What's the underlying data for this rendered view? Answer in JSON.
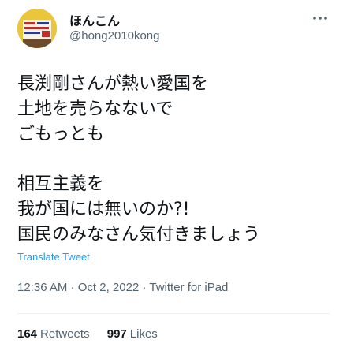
{
  "user": {
    "display_name": "ほんこん",
    "handle": "@hong2010kong",
    "avatar_icon": "profile-photo-icon"
  },
  "tweet": {
    "paragraphs": [
      [
        "長渕剛さんが熱い愛国を",
        "土地を売らなないで",
        "ごもっとも"
      ],
      [
        "相互主義を",
        "我が国には無いのか?!",
        "国民のみなさん気付きましょう"
      ]
    ],
    "translate_label": "Translate Tweet"
  },
  "meta": {
    "time": "12:36 AM",
    "separator1": " · ",
    "date": "Oct 2, 2022",
    "separator2": " · ",
    "source": "Twitter for iPad"
  },
  "stats": {
    "retweets_count": "164",
    "retweets_label": "Retweets",
    "likes_count": "997",
    "likes_label": "Likes"
  },
  "colors": {
    "link_blue": "#1d9bf0",
    "secondary_text": "#536471",
    "primary_text": "#0f1419"
  }
}
